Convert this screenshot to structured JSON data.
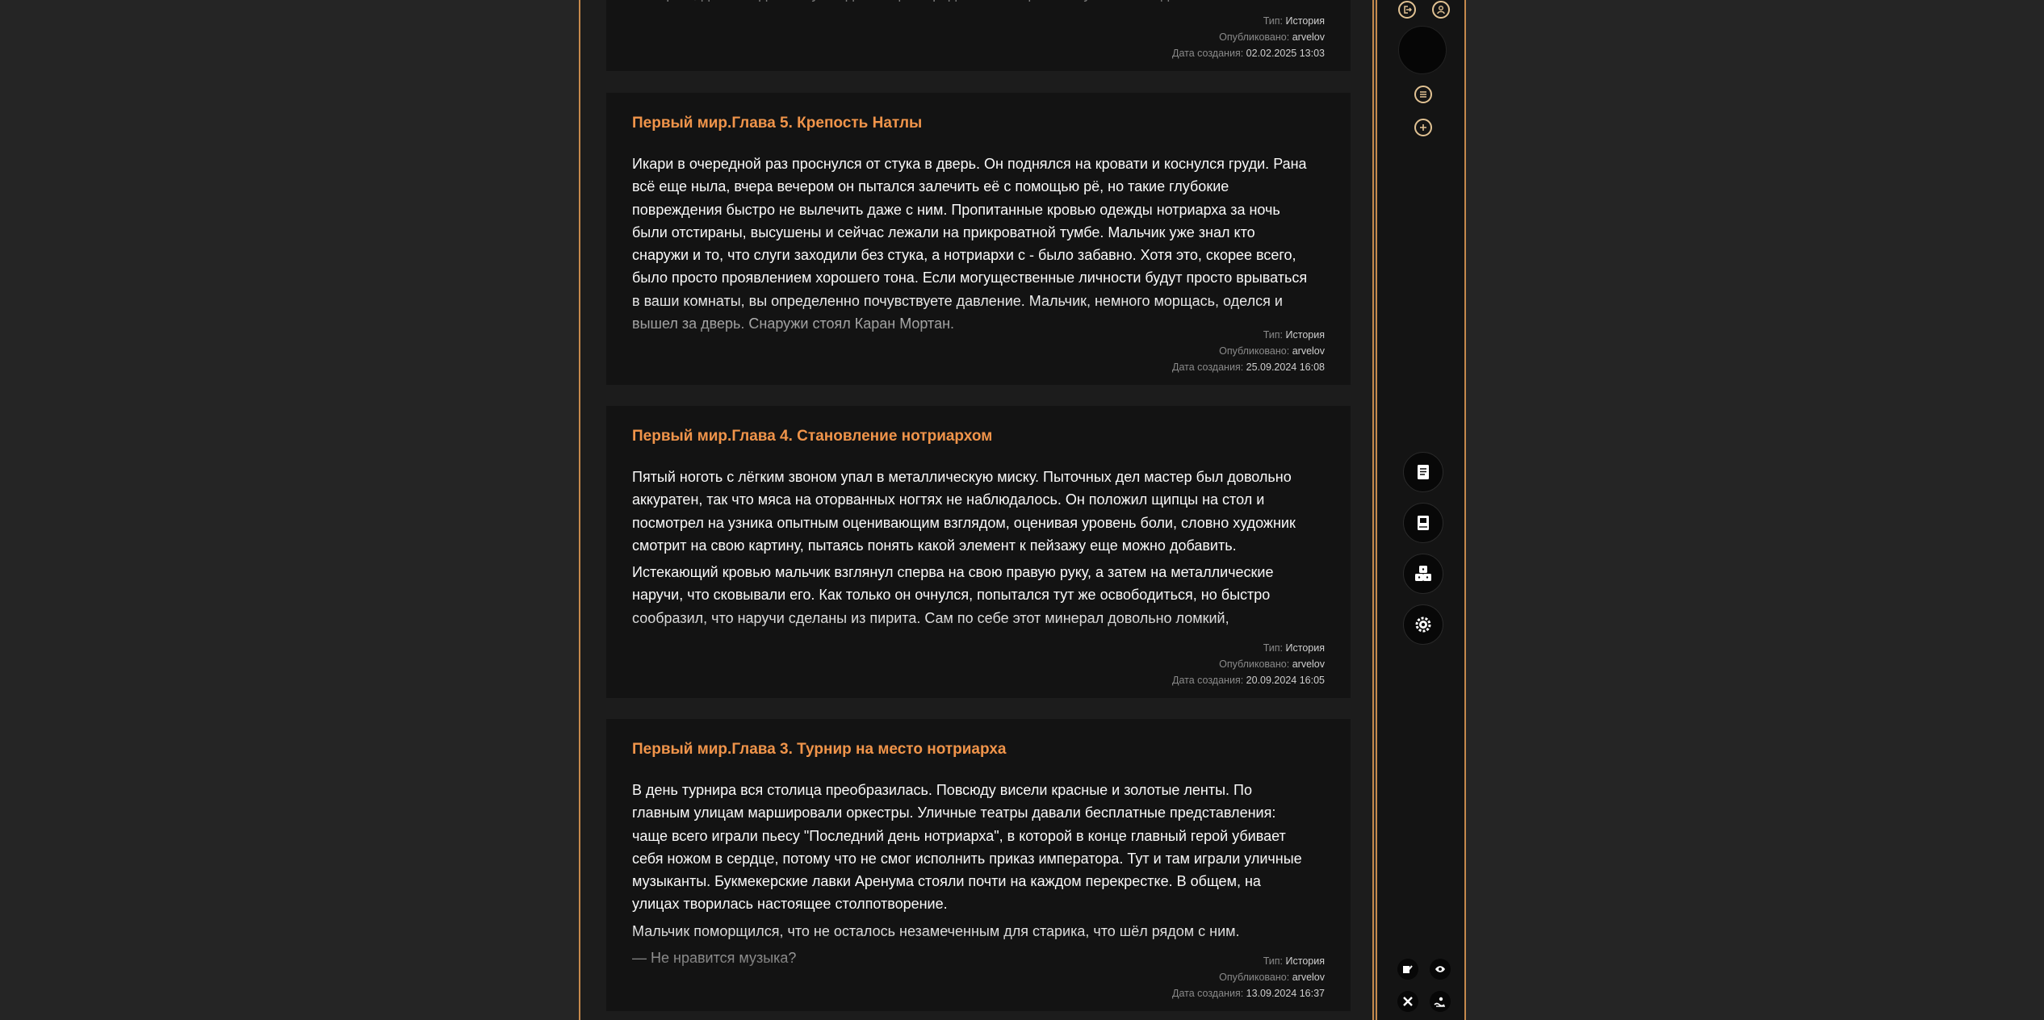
{
  "meta_labels": {
    "type": "Тип:",
    "published": "Опубликовано:",
    "created": "Дата создания:"
  },
  "cards": [
    {
      "title": "",
      "paragraphs": [
        "усердно стараемся ради черного престола уже с десяток лет. Мы проливали свой пот и кровь за империю, даже когда этот ублюдыш еще не родился! А еще его обучает господин"
      ],
      "type": "История",
      "author": "arvelov",
      "date": "02.02.2025 13:03"
    },
    {
      "title": "Первый мир.Глава 5. Крепость Натлы",
      "paragraphs": [
        "Икари в очередной раз проснулся от стука в дверь. Он поднялся на кровати и коснулся груди. Рана всё еще ныла, вчера вечером он пытался залечить её с помощью рё, но такие глубокие повреждения быстро не вылечить даже с ним. Пропитанные кровью одежды нотриарха за ночь были отстираны, высушены и сейчас лежали на прикроватной тумбе. Мальчик уже знал кто снаружи и то, что слуги заходили без стука, а нотриархи с - было забавно. Хотя это, скорее всего, было просто проявлением хорошего тона. Если могущественные личности будут просто врываться в ваши комнаты, вы определенно почувствуете давление. Мальчик, немного морщась, оделся и вышел за дверь. Снаружи стоял Каран Мортан."
      ],
      "type": "История",
      "author": "arvelov",
      "date": "25.09.2024 16:08"
    },
    {
      "title": "Первый мир.Глава 4. Становление нотриархом",
      "paragraphs": [
        "Пятый ноготь с лёгким звоном упал в металлическую миску. Пыточных дел мастер был довольно аккуратен, так что мяса на оторванных ногтях не наблюдалось. Он положил щипцы на стол и посмотрел на узника опытным оценивающим взглядом, оценивая уровень боли, словно художник смотрит на свою картину, пытаясь понять какой элемент к пейзажу еще можно добавить.",
        "Истекающий кровью мальчик взглянул сперва на свою правую руку, а затем на металлические наручи, что сковывали его. Как только он очнулся, попытался тут же освободиться, но быстро сообразил, что наручи сделаны из пирита. Сам по себе этот минерал довольно ломкий,"
      ],
      "type": "История",
      "author": "arvelov",
      "date": "20.09.2024 16:05"
    },
    {
      "title": "Первый мир.Глава 3. Турнир на место нотриарха",
      "paragraphs": [
        "В день турнира вся столица преобразилась. Повсюду висели красные и золотые ленты. По главным улицам маршировали оркестры. Уличные театры давали бесплатные представления: чаще всего играли пьесу \"Последний день нотриарха\", в которой в конце главный герой убивает себя ножом в сердце, потому что не смог исполнить приказ императора. Тут и там играли уличные музыканты. Букмекерские лавки Аренума стояли почти на каждом перекрестке. В общем, на улицах творилась настоящее столпотворение.",
        "Мальчик поморщился, что не осталось незамеченным для старика, что шёл рядом с ним.",
        "— Не нравится музыка?"
      ],
      "type": "История",
      "author": "arvelov",
      "date": "13.09.2024 16:37"
    }
  ],
  "rail": {
    "top_buttons": [
      "logout-icon",
      "profile-icon"
    ],
    "action_buttons": [
      "menu-icon",
      "plus-icon"
    ],
    "category_buttons": [
      "document-icon",
      "book-icon",
      "dice-icon",
      "gear-icon"
    ],
    "bottom_buttons": [
      "edit-icon",
      "eye-icon",
      "tools-icon",
      "theme-icon"
    ],
    "accent_color": "#c5894c",
    "title_color": "#f0944a"
  }
}
